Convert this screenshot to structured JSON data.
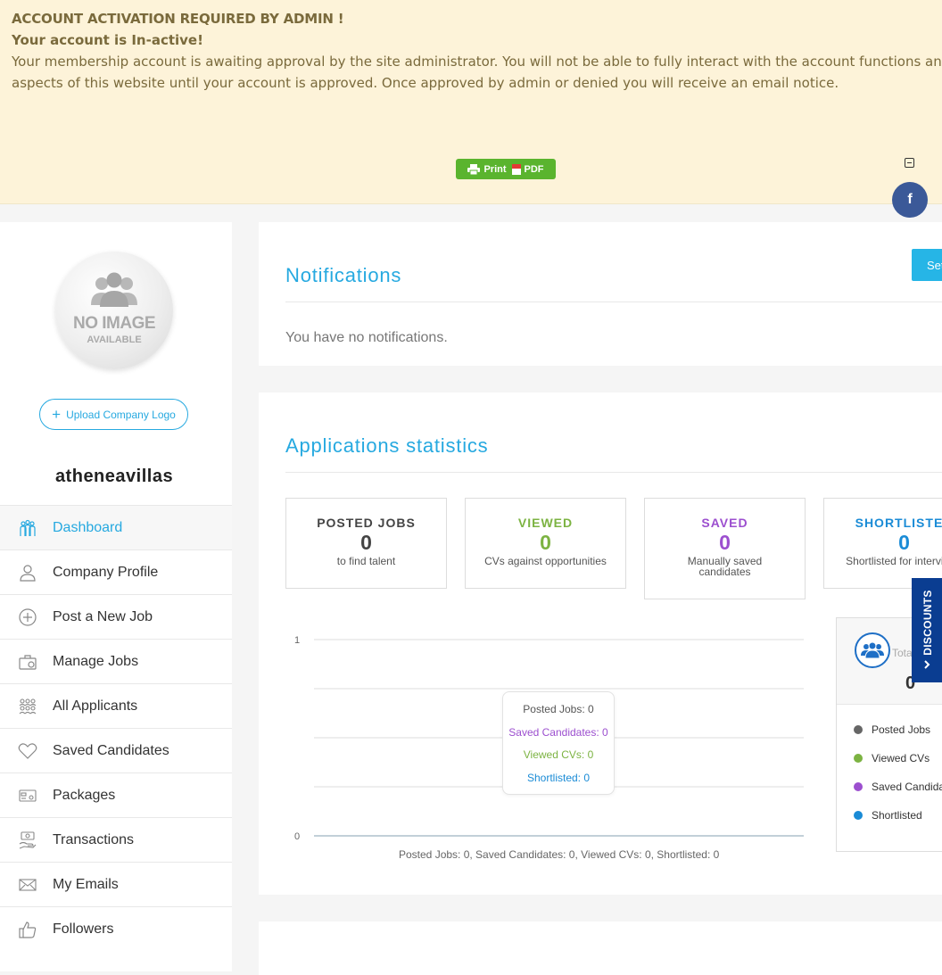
{
  "banner": {
    "title": "ACCOUNT ACTIVATION REQUIRED BY ADMIN !",
    "status": "Your account is In-active!",
    "message": "Your membership account is awaiting approval by the site administrator. You will not be able to fully interact with the account functions and aspects of this website until your account is approved. Once approved by admin or denied you will receive an email notice.",
    "print_label": "Print",
    "pdf_label": "PDF"
  },
  "sidebar": {
    "avatar_line1": "NO IMAGE",
    "avatar_line2": "AVAILABLE",
    "upload_label": "Upload Company Logo",
    "company_name": "atheneavillas",
    "items": [
      {
        "label": "Dashboard",
        "icon": "dashboard-icon",
        "active": true
      },
      {
        "label": "Company Profile",
        "icon": "user-icon"
      },
      {
        "label": "Post a New Job",
        "icon": "plus-circle-icon"
      },
      {
        "label": "Manage Jobs",
        "icon": "briefcase-icon"
      },
      {
        "label": "All Applicants",
        "icon": "applicants-icon"
      },
      {
        "label": "Saved Candidates",
        "icon": "heart-icon"
      },
      {
        "label": "Packages",
        "icon": "package-icon"
      },
      {
        "label": "Transactions",
        "icon": "transactions-icon"
      },
      {
        "label": "My Emails",
        "icon": "envelope-icon"
      },
      {
        "label": "Followers",
        "icon": "thumbs-up-icon"
      }
    ]
  },
  "notifications": {
    "title": "Notifications",
    "settings_label": "Set",
    "empty_text": "You have no notifications."
  },
  "stats": {
    "title": "Applications statistics",
    "boxes": [
      {
        "label": "POSTED JOBS",
        "value": "0",
        "desc": "to find talent",
        "color": "#444444"
      },
      {
        "label": "VIEWED",
        "value": "0",
        "desc": "CVs against opportunities",
        "color": "#7cb342"
      },
      {
        "label": "SAVED",
        "value": "0",
        "desc": "Manually saved candidates",
        "color": "#9c4fcf"
      },
      {
        "label": "SHORTLISTED",
        "value": "0",
        "desc": "Shortlisted for interviews",
        "color": "#1a8bd6"
      }
    ]
  },
  "chart_data": {
    "type": "line",
    "y_ticks": [
      "1",
      "0"
    ],
    "ylim": [
      0,
      1
    ],
    "series": [
      {
        "name": "Posted Jobs",
        "value": 0,
        "color": "#666666"
      },
      {
        "name": "Saved Candidates",
        "value": 0,
        "color": "#9c4fcf"
      },
      {
        "name": "Viewed CVs",
        "value": 0,
        "color": "#7cb342"
      },
      {
        "name": "Shortlisted",
        "value": 0,
        "color": "#1a8bd6"
      }
    ],
    "tooltip": [
      "Posted Jobs: 0",
      "Saved Candidates: 0",
      "Viewed CVs: 0",
      "Shortlisted: 0"
    ],
    "caption": "Posted Jobs: 0, Saved Candidates: 0, Viewed CVs: 0, Shortlisted: 0"
  },
  "legend": {
    "total_label": "Total",
    "total_value": "0",
    "items": [
      {
        "label": "Posted Jobs",
        "color": "#666666"
      },
      {
        "label": "Viewed CVs",
        "color": "#7cb342"
      },
      {
        "label": "Saved Candidates",
        "color": "#9c4fcf"
      },
      {
        "label": "Shortlisted",
        "color": "#1a8bd6"
      }
    ]
  },
  "discounts_label": "DISCOUNTS"
}
